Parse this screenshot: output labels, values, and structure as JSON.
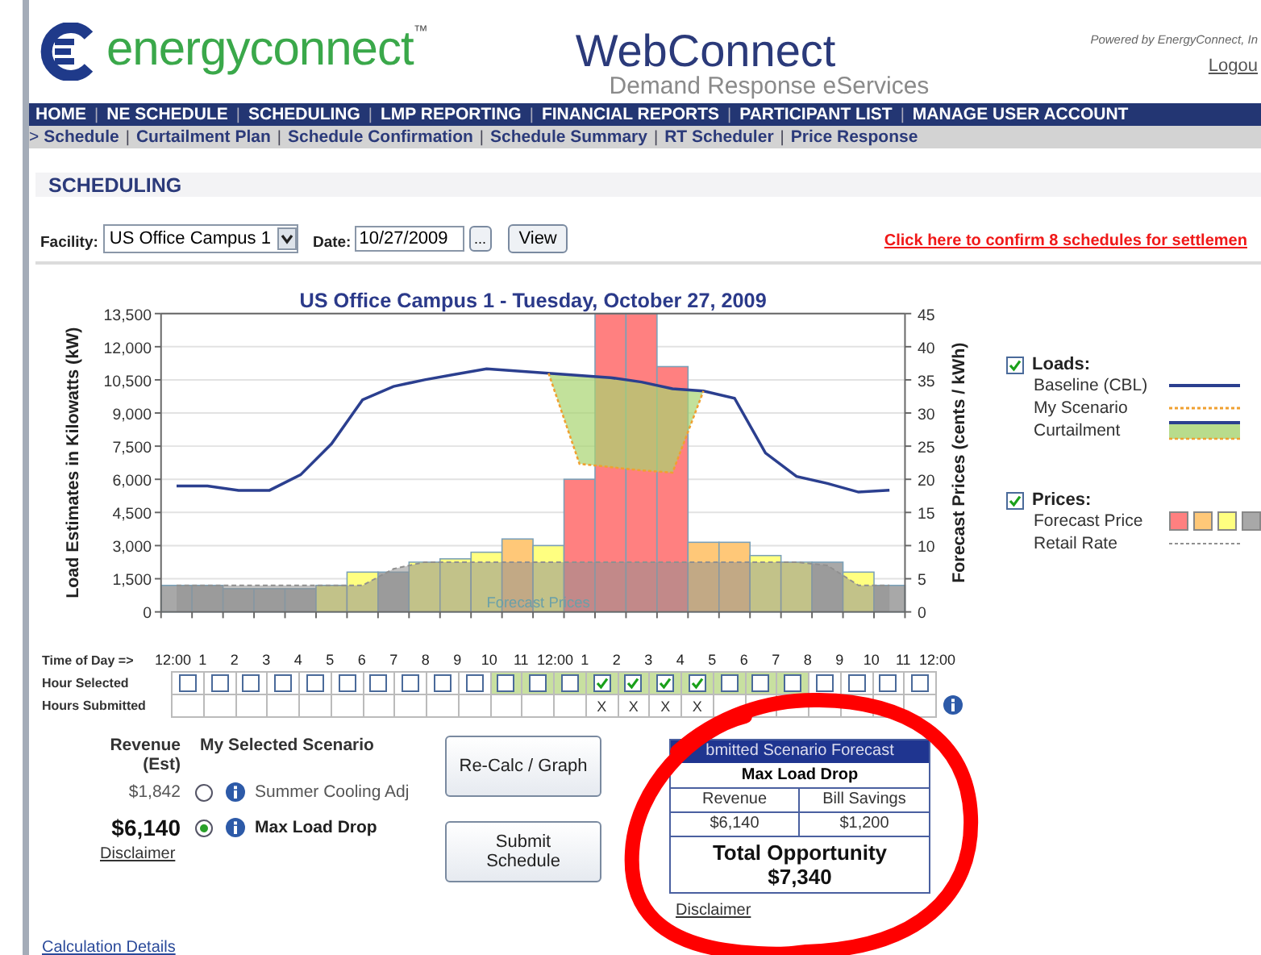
{
  "header": {
    "logo_text": "energyconnect$^{™}$",
    "title": "WebConnect",
    "subtitle": "Demand Response eServices",
    "powered_by": "Powered by EnergyConnect, In",
    "logout": "Logou"
  },
  "nav": {
    "separator": "|",
    "items": [
      "HOME",
      "NE SCHEDULE",
      "SCHEDULING",
      "LMP REPORTING",
      "FINANCIAL REPORTS",
      "PARTICIPANT LIST",
      "MANAGE USER ACCOUNT"
    ]
  },
  "subnav": {
    "prefix": ">",
    "separator": "|",
    "items": [
      "Schedule",
      "Curtailment Plan",
      "Schedule Confirmation",
      "Schedule Summary",
      "RT Scheduler",
      "Price Response"
    ]
  },
  "page_title": "SCHEDULING",
  "filters": {
    "facility_label": "Facility:",
    "facility_value": "US Office Campus 1",
    "date_label": "Date:",
    "date_value": "10/27/2009",
    "date_button": "...",
    "view_button": "View"
  },
  "confirm_link": "Click here to confirm 8 schedules for settlemen",
  "chart_data": {
    "type": "bar",
    "title": "US Office Campus 1 - Tuesday, October 27, 2009",
    "ylabel": "Load Estimates in Kilowatts (kW)",
    "y2label": "Forecast Prices (cents / kWh)",
    "categories": [
      null,
      null,
      null,
      null,
      null,
      null,
      null,
      null,
      null,
      null,
      null,
      null,
      null,
      null,
      null,
      null,
      null,
      null,
      null,
      null,
      null,
      null,
      null,
      null
    ],
    "ylim": [
      0,
      13500
    ],
    "y2lim": [
      0,
      45
    ],
    "grid": true,
    "yticks": [
      {
        "value": 0,
        "label": "0"
      },
      {
        "value": 1500,
        "label": "1,500"
      },
      {
        "value": 3000,
        "label": "3,000"
      },
      {
        "value": 4500,
        "label": "4,500"
      },
      {
        "value": 6000,
        "label": "6,000"
      },
      {
        "value": 7500,
        "label": "7,500"
      },
      {
        "value": 9000,
        "label": "9,000"
      },
      {
        "value": 10500,
        "label": "10,500"
      },
      {
        "value": 12000,
        "label": "12,000"
      },
      {
        "value": 13500,
        "label": "13,500"
      }
    ],
    "y2ticks": [
      0,
      5,
      10,
      15,
      20,
      25,
      30,
      35,
      40,
      45
    ],
    "series": [
      {
        "name": "Forecast Price",
        "type": "bar",
        "axis": "y2",
        "values": [
          4,
          4,
          3.5,
          3.5,
          3.5,
          4,
          6,
          6,
          7.5,
          8,
          9,
          11,
          10,
          20,
          45,
          45,
          37,
          10.5,
          10.5,
          8.5,
          7.5,
          7.5,
          6,
          4
        ],
        "colors": [
          "#a8a8a8",
          "#a8a8a8",
          "#a8a8a8",
          "#a8a8a8",
          "#a8a8a8",
          "#ffff80",
          "#ffff80",
          "#a8a8a8",
          "#ffff80",
          "#ffff80",
          "#ffff80",
          "#ffc878",
          "#ffff80",
          "#ff8080",
          "#ff8080",
          "#ff8080",
          "#ff8080",
          "#ffc878",
          "#ffc878",
          "#ffff80",
          "#ffff80",
          "#a8a8a8",
          "#ffff80",
          "#a8a8a8"
        ]
      },
      {
        "name": "Retail Rate",
        "type": "area",
        "axis": "y2",
        "color": "#909090",
        "line_style": "dashed",
        "values": [
          4,
          4,
          4,
          4,
          4,
          4,
          4,
          6.5,
          7.5,
          7.5,
          7.5,
          7.5,
          7.5,
          7.5,
          7.5,
          7.5,
          7.5,
          7.5,
          7.5,
          7.5,
          7.5,
          7,
          4,
          4
        ]
      },
      {
        "name": "Baseline (CBL)",
        "type": "line",
        "color": "#2b3f8f",
        "values": [
          5700,
          5700,
          5500,
          5500,
          6200,
          7600,
          9600,
          10200,
          10500,
          10750,
          11000,
          10900,
          10800,
          10700,
          10600,
          10400,
          10100,
          10000,
          9670,
          7190,
          6130,
          5810,
          5420,
          5510
        ]
      },
      {
        "name": "My Scenario",
        "type": "line",
        "line_style": "dashed",
        "color": "#f0a030",
        "values": [
          null,
          null,
          null,
          null,
          null,
          null,
          null,
          null,
          null,
          null,
          null,
          null,
          10800,
          6700,
          6550,
          6400,
          6300,
          10000,
          null,
          null,
          null,
          null,
          null,
          null
        ]
      }
    ],
    "annotations": [
      "Forecast Prices"
    ]
  },
  "legend": {
    "groups": [
      {
        "label": "Loads:",
        "checked": true,
        "kind": "loads",
        "extra": [
          {
            "label": "Curtailment",
            "kind": "band"
          }
        ]
      },
      {
        "label": "Prices:",
        "checked": true,
        "kind": "prices"
      }
    ]
  },
  "hours": {
    "time_label": "Time of Day =>",
    "selected_label": "Hour Selected",
    "submitted_label": "Hours Submitted",
    "times": [
      "12:00",
      "1",
      "2",
      "3",
      "4",
      "5",
      "6",
      "7",
      "8",
      "9",
      "10",
      "11",
      "12:00",
      "1",
      "2",
      "3",
      "4",
      "5",
      "6",
      "7",
      "8",
      "9",
      "10",
      "11",
      "12:00"
    ],
    "cells": [
      {
        "peak": false,
        "checked": false
      },
      {
        "peak": false,
        "checked": false
      },
      {
        "peak": false,
        "checked": false
      },
      {
        "peak": false,
        "checked": false
      },
      {
        "peak": false,
        "checked": false
      },
      {
        "peak": false,
        "checked": false
      },
      {
        "peak": false,
        "checked": false
      },
      {
        "peak": false,
        "checked": false
      },
      {
        "peak": false,
        "checked": false
      },
      {
        "peak": false,
        "checked": false
      },
      {
        "peak": true,
        "checked": false
      },
      {
        "peak": true,
        "checked": false
      },
      {
        "peak": true,
        "checked": false
      },
      {
        "peak": true,
        "checked": true,
        "submitted": "X"
      },
      {
        "peak": true,
        "checked": true,
        "submitted": "X"
      },
      {
        "peak": true,
        "checked": true,
        "submitted": "X"
      },
      {
        "peak": true,
        "checked": true,
        "submitted": "X"
      },
      {
        "peak": true,
        "checked": false
      },
      {
        "peak": true,
        "checked": false
      },
      {
        "peak": true,
        "checked": false
      },
      {
        "peak": false,
        "checked": false
      },
      {
        "peak": false,
        "checked": false
      },
      {
        "peak": false,
        "checked": false
      },
      {
        "peak": false,
        "checked": false
      }
    ]
  },
  "scenarios": {
    "revenue_header": "Revenue (Est)",
    "scenario_header": "My Selected Scenario",
    "disclaimer": "Disclaimer",
    "items": [
      {
        "revenue": "$1,842",
        "name": "Summer Cooling Adj",
        "selected": false
      },
      {
        "revenue": "$6,140",
        "name": "Max Load Drop",
        "selected": true
      }
    ]
  },
  "buttons": [
    "Re-Calc / Graph",
    "Submit Schedule"
  ],
  "forecast": {
    "header": "bmitted Scenario Forecast",
    "scenario": "Max Load Drop",
    "columns": [
      "Revenue",
      "Bill Savings"
    ],
    "values": [
      "$6,140",
      "$1,200"
    ],
    "total_label": "Total Opportunity",
    "total_value": "$7,340",
    "disclaimer": "Disclaimer"
  },
  "footer_link": "Calculation Details"
}
